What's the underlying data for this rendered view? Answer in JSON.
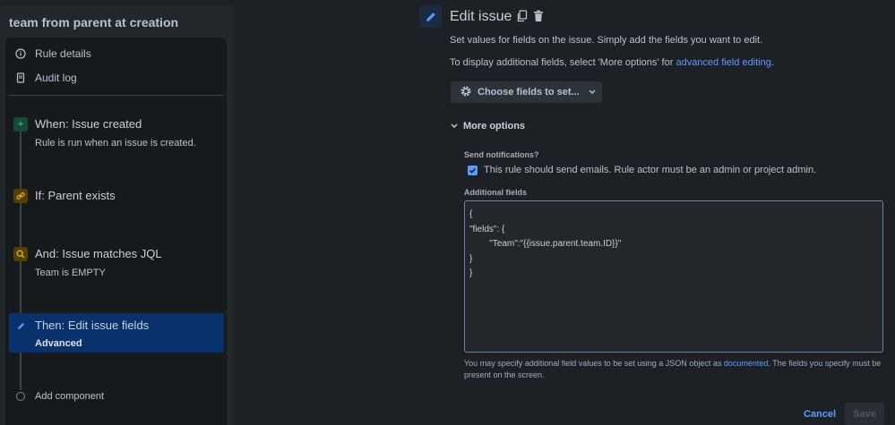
{
  "sidebar": {
    "rule_title": "team from parent at creation",
    "nav": [
      {
        "label": "Rule details",
        "icon": "info-icon"
      },
      {
        "label": "Audit log",
        "icon": "document-icon"
      }
    ],
    "steps": [
      {
        "title": "When: Issue created",
        "subtitle": "Rule is run when an issue is created.",
        "icon": "plus-icon",
        "color": "#4bce97"
      },
      {
        "title": "If: Parent exists",
        "subtitle": "",
        "icon": "link-icon",
        "color": "#e2b203"
      },
      {
        "title": "And: Issue matches JQL",
        "subtitle": "Team is EMPTY",
        "icon": "search-icon",
        "color": "#e2b203"
      },
      {
        "title": "Then: Edit issue fields",
        "subtitle": "Advanced",
        "icon": "pencil-icon",
        "color": "#579dff"
      }
    ],
    "add_component": "Add component"
  },
  "main": {
    "title": "Edit issue",
    "description": "Set values for fields on the issue. Simply add the fields you want to edit.",
    "display_text": "To display additional fields, select 'More options' for ",
    "display_link": "advanced field editing",
    "display_suffix": ".",
    "choose_fields": "Choose fields to set...",
    "more_options": "More options",
    "send_notifications_label": "Send notifications?",
    "send_notifications_text": "This rule should send emails. Rule actor must be an admin or project admin.",
    "send_notifications_checked": true,
    "additional_fields_label": "Additional fields",
    "additional_fields_value": "{\n\"fields\": {\n        \"Team\":\"{{issue.parent.team.ID}}\"\n}\n}",
    "helper_prefix": "You may specify additional field values to be set using a JSON object as ",
    "helper_link": "documented",
    "helper_suffix": ". The fields you specify must be present on the screen.",
    "cancel": "Cancel",
    "save": "Save"
  },
  "colors": {
    "accent": "#579dff",
    "active_step_bg": "#09326c"
  }
}
